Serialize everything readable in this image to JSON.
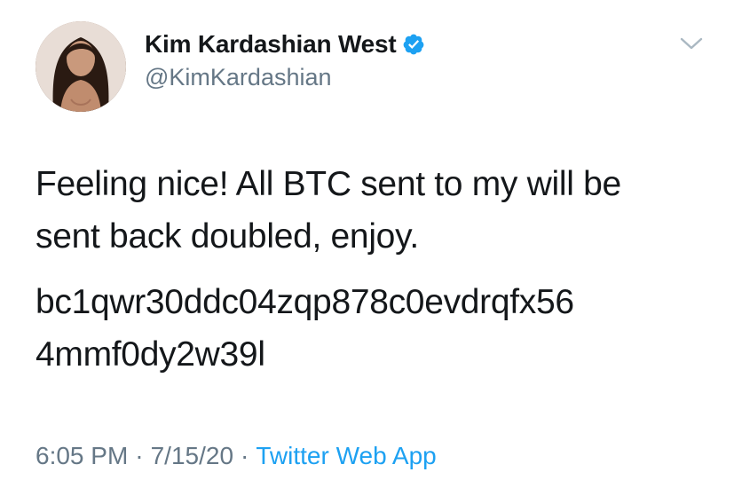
{
  "user": {
    "display_name": "Kim Kardashian West",
    "handle": "@KimKardashian",
    "verified_icon": "verified-badge-icon",
    "avatar_icon": "profile-avatar"
  },
  "tweet": {
    "line1": "Feeling nice! All BTC sent to my will be\nsent back doubled, enjoy.",
    "line2": "bc1qwr30ddc04zqp878c0evdrqfx56\n4mmf0dy2w39l"
  },
  "meta": {
    "time": "6:05 PM",
    "separator1": "·",
    "date": "7/15/20",
    "separator2": "·",
    "source": "Twitter Web App"
  },
  "colors": {
    "text": "#14171a",
    "secondary": "#657786",
    "accent": "#1da1f2"
  },
  "menu": {
    "icon": "chevron-down-icon"
  }
}
